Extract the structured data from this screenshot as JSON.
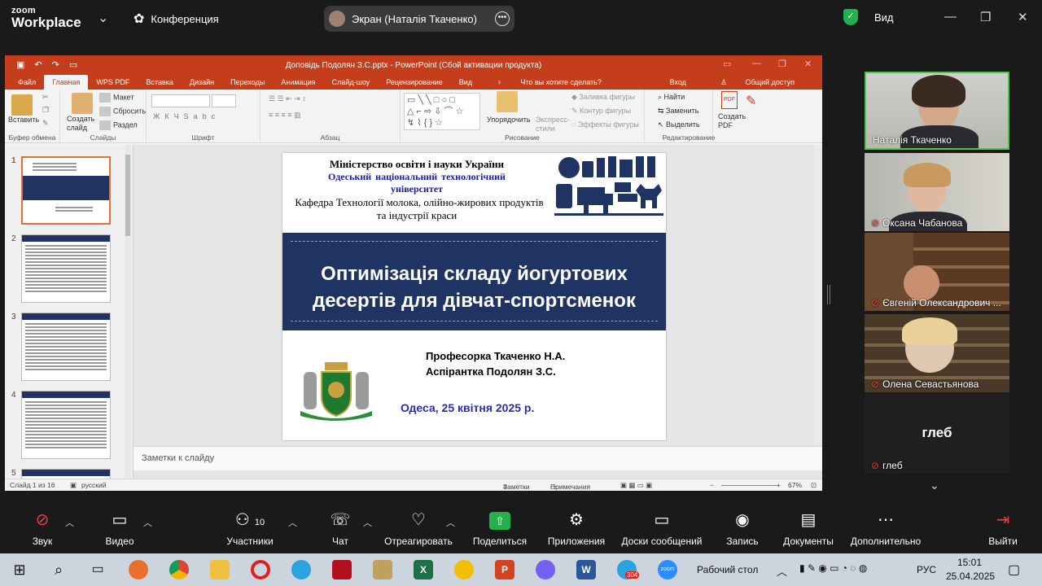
{
  "zoom": {
    "logo_line1": "zoom",
    "logo_line2": "Workplace",
    "conference_label": "Конференция",
    "screen_share_label": "Экран (Наталія Ткаченко)",
    "view_label": "Вид"
  },
  "ppt": {
    "window_title": "Доповідь Подолян З.С.pptx - PowerPoint (Сбой активации продукта)",
    "tabs": [
      "Файл",
      "Главная",
      "WPS PDF",
      "Вставка",
      "Дизайн",
      "Переходы",
      "Анимация",
      "Слайд-шоу",
      "Рецензирование",
      "Вид"
    ],
    "active_tab": "Главная",
    "tell_me": "Что вы хотите сделать?",
    "sign_in": "Вход",
    "share": "Общий доступ",
    "ribbon": {
      "paste": "Вставить",
      "clipboard": "Буфер обмена",
      "new_slide": "Создать слайд",
      "layout": "Макет",
      "reset": "Сбросить",
      "section": "Раздел",
      "slides_group": "Слайды",
      "font_group": "Шрифт",
      "paragraph_group": "Абзац",
      "arrange": "Упорядочить",
      "quick_styles": "Экспресс-стили",
      "shape_fill": "Заливка фигуры",
      "shape_outline": "Контур фигуры",
      "shape_effects": "Эффекты фигуры",
      "drawing_group": "Рисование",
      "find": "Найти",
      "replace": "Заменить",
      "select": "Выделить",
      "editing_group": "Редактирование",
      "create_pdf": "Создать PDF",
      "font_buttons": [
        "Ж",
        "К",
        "Ч",
        "S",
        "abc"
      ]
    },
    "thumbnails": [
      "1",
      "2",
      "3",
      "4",
      "5"
    ],
    "slide": {
      "ministry": "Міністерство освіти і науки України",
      "university_line1": "Одеський  національний  технологічний",
      "university_line2": "університет",
      "department_line1": "Кафедра Технології молока, олійно-жирових продуктів",
      "department_line2": "та індустрії краси",
      "title_line1": "Оптимізація складу йогуртових",
      "title_line2": "десертів для дівчат-спортсменок",
      "professor": "Професорка Ткаченко Н.А.",
      "student": "Аспірантка Подолян З.С.",
      "date": "Одеса, 25 квітня 2025 р."
    },
    "notes_placeholder": "Заметки к слайду",
    "status": {
      "slide_of": "Слайд 1 из 16",
      "language": "русский",
      "notes": "Заметки",
      "comments": "Примечания",
      "zoom": "67%"
    }
  },
  "participants": [
    {
      "name": "Наталія Ткаченко",
      "muted": false
    },
    {
      "name": "Оксана Чабанова",
      "muted": true
    },
    {
      "name": "Євгеній Олександрович ...",
      "muted": true
    },
    {
      "name": "Олена Севастьянова",
      "muted": true
    },
    {
      "name": "глеб",
      "muted": true,
      "big_name": "глеб"
    }
  ],
  "toolbar": {
    "audio": "Звук",
    "video": "Видео",
    "participants": "Участники",
    "participants_count": "10",
    "chat": "Чат",
    "react": "Отреагировать",
    "share": "Поделиться",
    "apps": "Приложения",
    "whiteboards": "Доски сообщений",
    "record": "Запись",
    "docs": "Документы",
    "more": "Дополнительно",
    "leave": "Выйти"
  },
  "taskbar": {
    "desktop": "Рабочий стол",
    "lang": "РУС",
    "time": "15:01",
    "date": "25.04.2025",
    "telegram_badge": "304",
    "zoom_icon_label": "zoom"
  },
  "colors": {
    "ppt_accent": "#c43e1c",
    "slide_band": "#1f3462",
    "active_speaker": "#49c84e",
    "share_green": "#22b14c"
  }
}
